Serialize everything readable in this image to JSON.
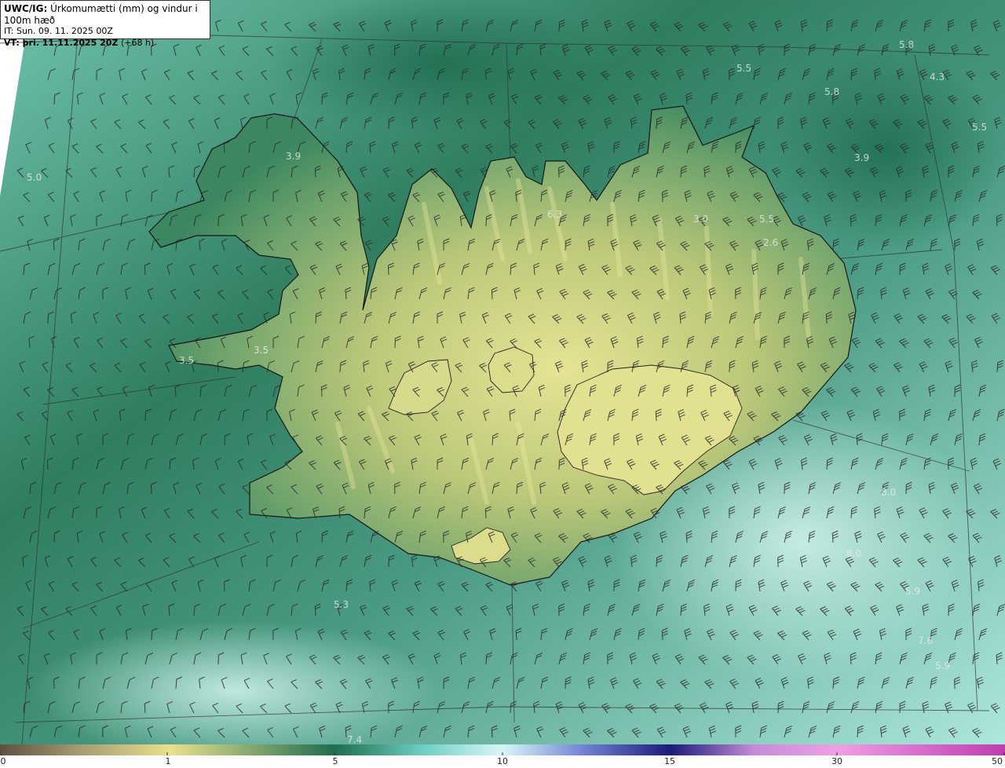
{
  "header": {
    "source": "UWC/IG:",
    "title": "Úrkomumætti (mm) og vindur i 100m hæð",
    "init_time": "IT: Sun. 09. 11. 2025 00Z",
    "valid_label": "VT: þri. 11.11.2025 20Z",
    "lead_time": "(+68 h)"
  },
  "colorbar": {
    "ticks": [
      "0",
      "1",
      "5",
      "10",
      "15",
      "30",
      "50"
    ],
    "colors": [
      "#5e5040",
      "#a79c71",
      "#e9e08d",
      "#1e6d4e",
      "#6ccfc1",
      "#d9f6f7",
      "#7283d2",
      "#1a1a7a",
      "#c58bd8",
      "#ef9fe6",
      "#c03bb0"
    ]
  },
  "value_labels": [
    "5.8",
    "5.5",
    "4.3",
    "5.8",
    "5.5",
    "3.9",
    "3.9",
    "5.0",
    "6.3",
    "3.0",
    "5.5",
    "2.6",
    "3.5",
    "3.5",
    "8.0",
    "8.0",
    "5.9",
    "7.6",
    "5.9",
    "5.3",
    "7.4"
  ],
  "map_colors": {
    "sea_dark": "#2c7a5d",
    "sea_mid": "#4c9d85",
    "sea_light": "#9fe0d6",
    "land_low": "#3f8a62",
    "land_high": "#dfe08d",
    "coast": "#1c1c1c",
    "grid": "#3a3a3a"
  }
}
